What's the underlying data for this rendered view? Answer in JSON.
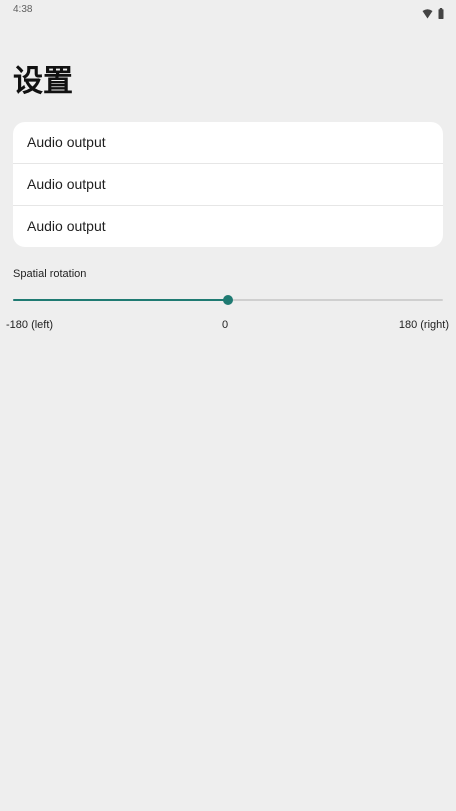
{
  "status_bar": {
    "time": "4:38",
    "icons": [
      "wifi-icon",
      "battery-icon"
    ]
  },
  "page": {
    "title": "设置"
  },
  "settings_list": {
    "items": [
      {
        "label": "Audio output"
      },
      {
        "label": "Audio output"
      },
      {
        "label": "Audio output"
      }
    ]
  },
  "spatial_rotation": {
    "label": "Spatial rotation",
    "min": -180,
    "max": 180,
    "value": 0,
    "min_label": "-180 (left)",
    "mid_label": "0",
    "max_label": "180 (right)"
  },
  "colors": {
    "accent": "#1f7a72",
    "background": "#eeeeee",
    "card": "#ffffff",
    "track": "#cfcfcf"
  }
}
